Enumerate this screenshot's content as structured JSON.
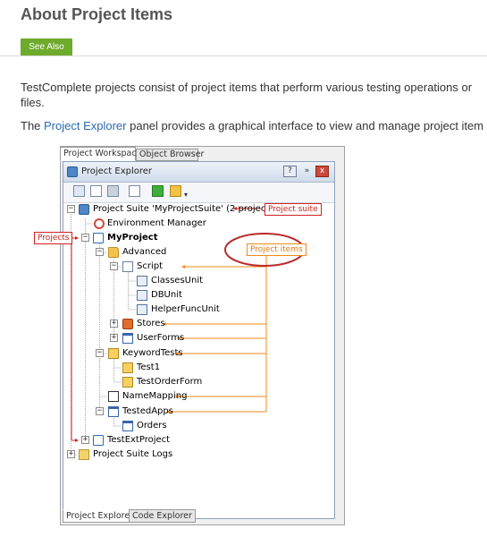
{
  "header": {
    "title": "About Project Items",
    "see_also_label": "See Also"
  },
  "body": {
    "para1_line1": "TestComplete projects consist of project items that perform various testing operations or",
    "para1_line2": "files.",
    "para2_prefix": "The ",
    "para2_link": "Project Explorer",
    "para2_suffix": " panel provides a graphical interface to view and manage project item"
  },
  "workspace": {
    "tabs": [
      "Project Workspace",
      "Object Browser"
    ],
    "panel_title": "Project Explorer",
    "header_buttons": [
      "?",
      "»",
      "x"
    ],
    "bottom_tabs": [
      "Project Explorer",
      "Code Explorer"
    ]
  },
  "tree": {
    "suite": "Project Suite 'MyProjectSuite' (2 projects)",
    "env_manager": "Environment Manager",
    "my_project": "MyProject",
    "advanced": "Advanced",
    "script": "Script",
    "classes_unit": "ClassesUnit",
    "db_unit": "DBUnit",
    "helper_unit": "HelperFuncUnit",
    "stores": "Stores",
    "user_forms": "UserForms",
    "keyword_tests": "KeywordTests",
    "test1": "Test1",
    "test_order_form": "TestOrderForm",
    "name_mapping": "NameMapping",
    "tested_apps": "TestedApps",
    "orders": "Orders",
    "test_ext_project": "TestExtProject",
    "suite_logs": "Project Suite Logs"
  },
  "callouts": {
    "project_suite": "Project suite",
    "projects": "Projects",
    "project_items": "Project items"
  },
  "colors": {
    "see_also_bg": "#6eaa2c",
    "link": "#2a6ab0",
    "callout_red": "#d02020",
    "callout_orange": "#f08a1a"
  }
}
